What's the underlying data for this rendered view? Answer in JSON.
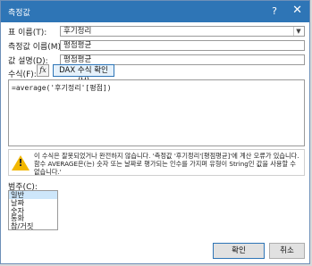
{
  "window": {
    "title": "측정값",
    "help_icon": "help-icon",
    "close_icon": "close-icon"
  },
  "form": {
    "table_label": "표 이름(T):",
    "table_value": "후기정리",
    "measure_label": "측정값 이름(M):",
    "measure_value": "평점평균",
    "desc_label": "값 설명(D):",
    "desc_value": "평점평균",
    "formula_label": "수식(F):",
    "fx_label": "fx",
    "dax_button": "DAX 수식 확인(H)"
  },
  "formula": {
    "text": "=average('후기정리'[평점])"
  },
  "error": {
    "text": "이 수식은 잘못되었거나 완전하지 않습니다. '측정값 '후기정리'[평점평균]'에 계산 오류가 있습니다. 함수 AVERAGE은(는) 숫자 또는 날짜로 평가되는 인수를 가지며 유형이 String인 값을 사용할 수 없습니다.'"
  },
  "category": {
    "label": "범주(C):",
    "items": [
      "일반",
      "날짜",
      "숫자",
      "통화",
      "참/거짓"
    ],
    "selected": "일반"
  },
  "buttons": {
    "ok": "확인",
    "cancel": "취소"
  },
  "colors": {
    "accent": "#2e75b6",
    "warning": "#f2b700"
  }
}
